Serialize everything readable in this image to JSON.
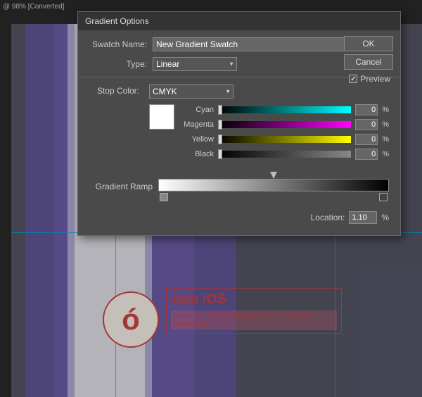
{
  "toolbar": {
    "label": "@ 98% [Converted]"
  },
  "dialog": {
    "title": "Gradient Options",
    "swatch_name_label": "Swatch Name:",
    "swatch_name_value": "New Gradient Swatch",
    "type_label": "Type:",
    "type_value": "Linear",
    "ok_label": "OK",
    "cancel_label": "Cancel",
    "preview_label": "Preview",
    "preview_checked": "✓",
    "stop_color_label": "Stop Color:",
    "stop_color_value": "CMYK",
    "cyan_label": "Cyan",
    "cyan_value": "0",
    "magenta_label": "Magenta",
    "magenta_value": "0",
    "yellow_label": "Yellow",
    "yellow_value": "0",
    "black_label": "Black",
    "black_value": "0",
    "gradient_ramp_label": "Gradient Ramp",
    "location_label": "Location:",
    "location_value": "1.10",
    "percent": "%"
  },
  "canvas": {
    "app_title": "App iOS",
    "app_subtitle": "oxtae seri autecer ferum, commod meliuets",
    "app_subtitle2": "butam rem sunt ant",
    "icon_char": "ó"
  }
}
